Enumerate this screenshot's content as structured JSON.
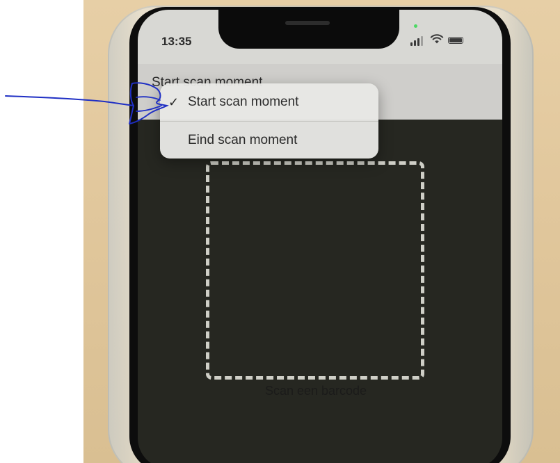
{
  "status_bar": {
    "time": "13:35",
    "signal_icon": "cellular-signal-icon",
    "wifi_icon": "wifi-icon",
    "battery_icon": "battery-icon"
  },
  "header": {
    "title": "Start scan moment"
  },
  "dropdown_menu": {
    "items": [
      {
        "label": "Start scan moment",
        "checked": true,
        "check_glyph": "✓"
      },
      {
        "label": "Eind scan moment",
        "checked": false,
        "check_glyph": ""
      }
    ]
  },
  "scanner": {
    "hint": "Scan een barcode"
  },
  "colors": {
    "annotation_ink": "#1f2fc4",
    "scanner_background": "#262721",
    "menu_background": "#e8e8e5"
  }
}
